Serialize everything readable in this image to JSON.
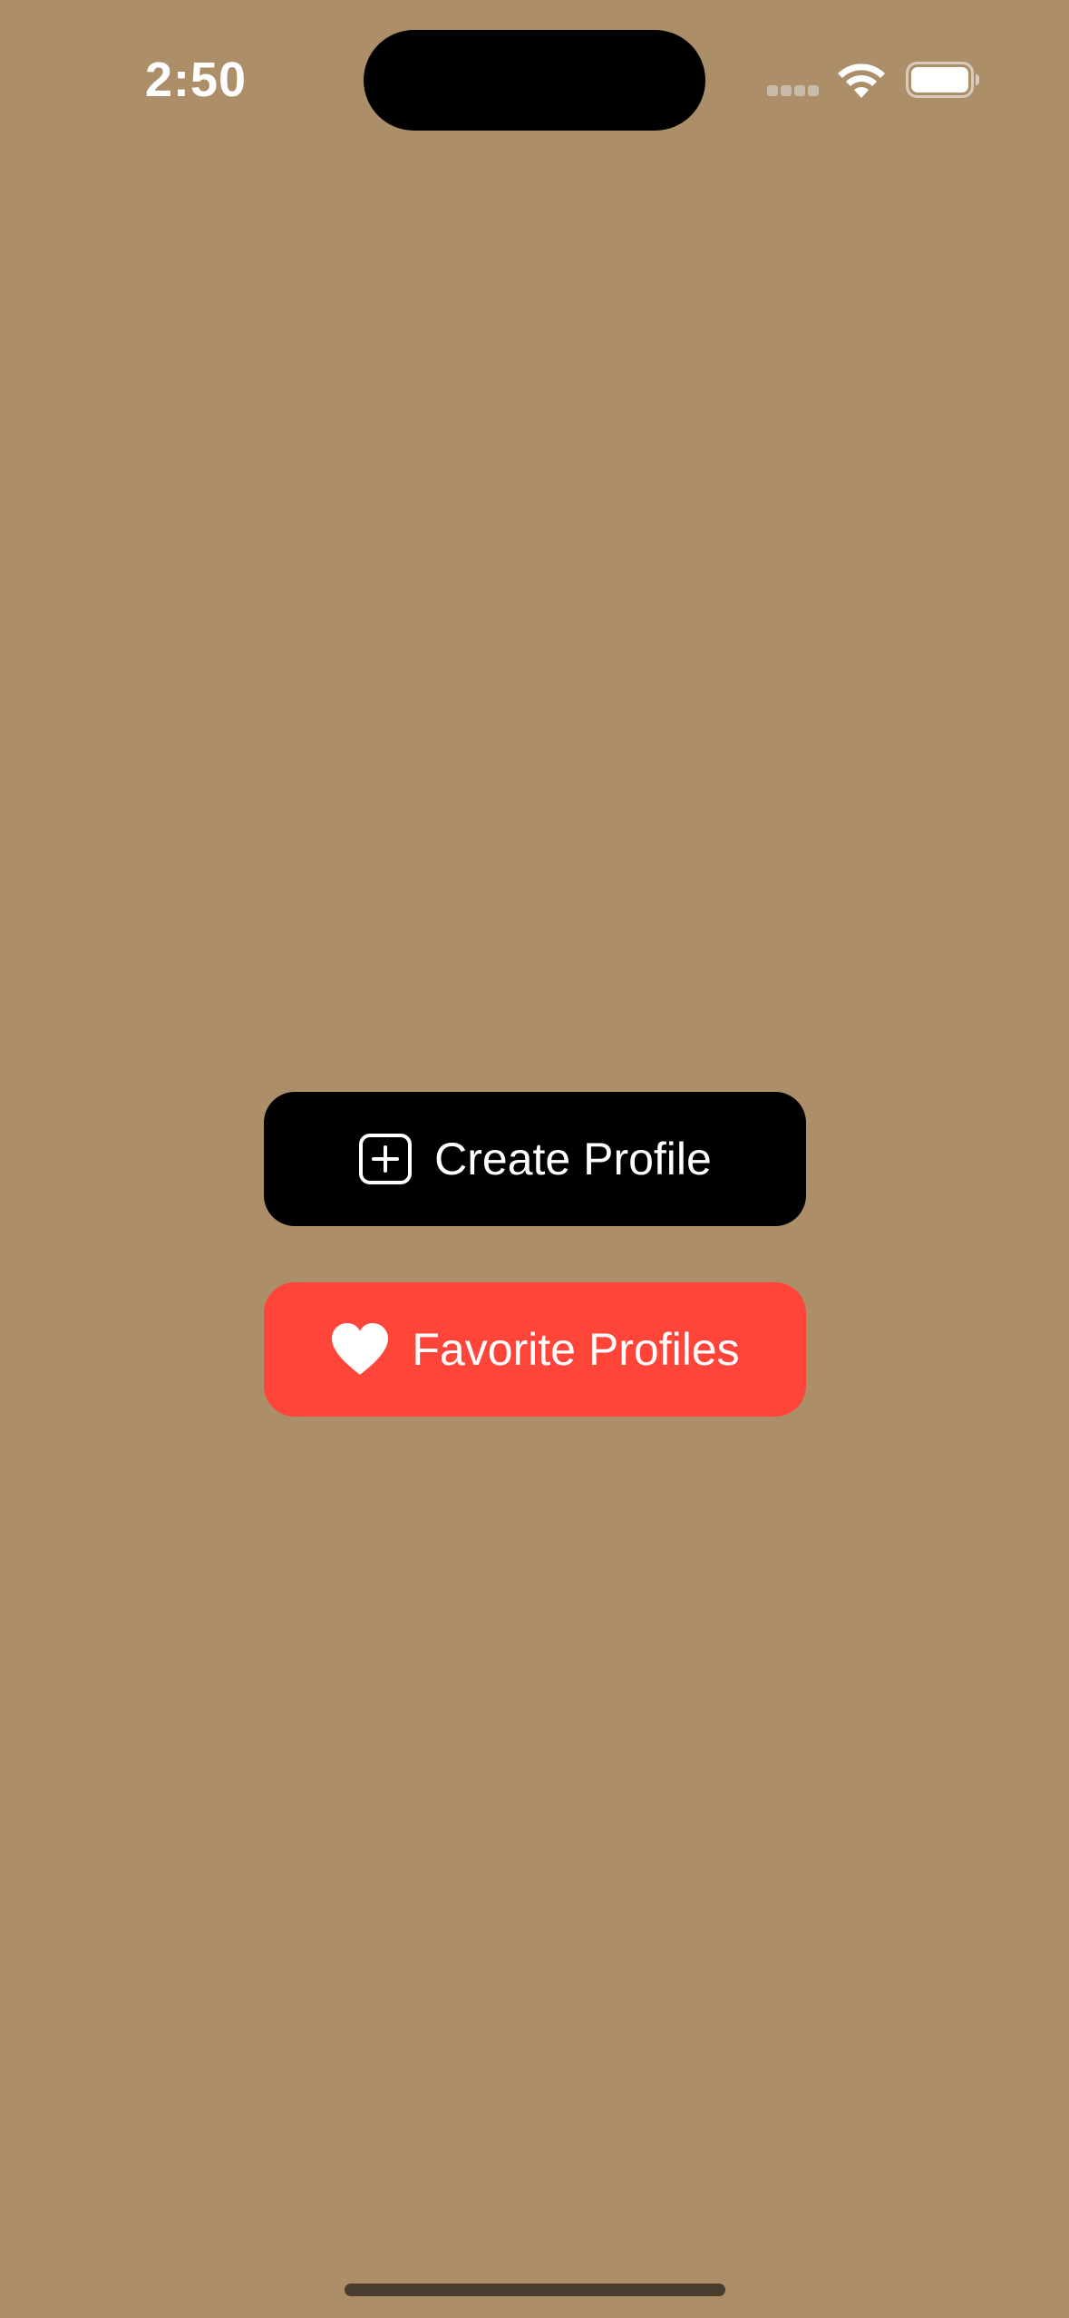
{
  "status_bar": {
    "time": "2:50"
  },
  "colors": {
    "background": "#AC8E69",
    "create_button": "#000000",
    "favorite_button": "#FF453A",
    "text": "#FFFFFF"
  },
  "actions": {
    "create_profile": {
      "label": "Create Profile",
      "icon": "plus-square-icon"
    },
    "favorite_profiles": {
      "label": "Favorite Profiles",
      "icon": "heart-icon"
    }
  }
}
